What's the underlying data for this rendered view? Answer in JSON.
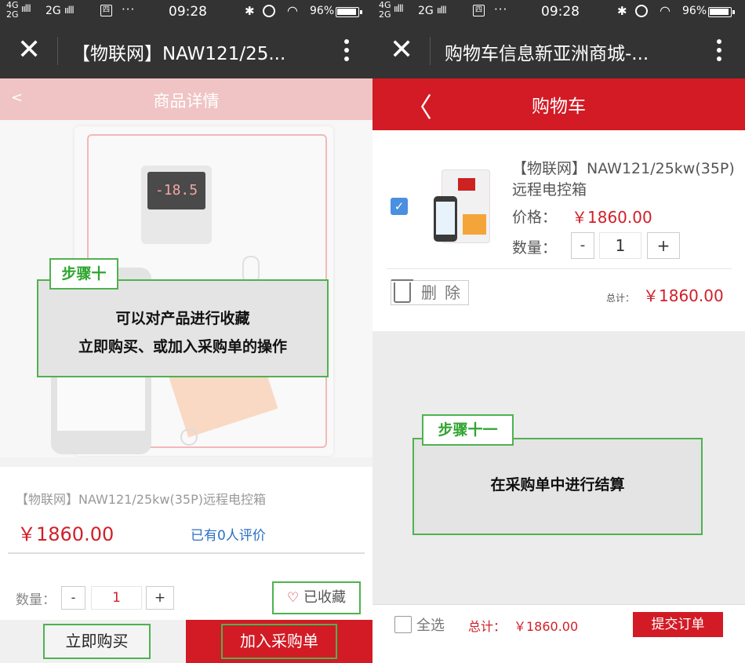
{
  "status_bar": {
    "net_top": "4G",
    "net_bottom": "2G",
    "net_second": "2G",
    "signal_glyph": "ıılll",
    "msg_glyph": "四",
    "dots": "···",
    "time": "09:28",
    "bt_glyph": "✱",
    "wifi_glyph": "◠",
    "battery": "96%"
  },
  "left": {
    "app_title": "【物联网】NAW121/25...",
    "sub_header_title": "商品详情",
    "back_glyph": "<",
    "lcd_text": "-18.5",
    "step": {
      "tag": "步骤十",
      "line1": "可以对产品进行收藏",
      "line2": "立即购买、或加入采购单的操作"
    },
    "product_name": "【物联网】NAW121/25kw(35P)远程电控箱",
    "price": "￥1860.00",
    "reviews": "已有0人评价",
    "qty_label": "数量：",
    "qty_minus": "-",
    "qty_value": "1",
    "qty_plus": "+",
    "fav_heart": "♡",
    "fav_label": "已收藏",
    "buy_now": "立即购买",
    "add_to_po": "加入采购单"
  },
  "right": {
    "app_title": "购物车信息新亚洲商城-...",
    "header_title": "购物车",
    "back_glyph": "〈",
    "check_glyph": "✓",
    "item_name": "【物联网】NAW121/25kw(35P)远程电控箱",
    "price_label": "价格：",
    "price": "￥1860.00",
    "qty_label": "数量：",
    "qty_minus": "-",
    "qty_value": "1",
    "qty_plus": "+",
    "delete_label": "删除",
    "total_label": "总计：",
    "total": "￥1860.00",
    "step": {
      "tag": "步骤十一",
      "text": "在采购单中进行结算"
    },
    "select_all": "全选",
    "footer_total_label": "总计：",
    "footer_total": "￥1860.00",
    "submit": "提交订单"
  },
  "colors": {
    "brand_red": "#d21b25",
    "price_red": "#d0202a",
    "step_green": "#4fb24f",
    "link_blue": "#2a70c4",
    "dark_bar": "#333333"
  },
  "icons": [
    "close-icon",
    "more-icon",
    "back-icon",
    "heart-icon",
    "trash-icon",
    "checkbox-icon",
    "battery-icon",
    "wifi-icon",
    "bluetooth-icon",
    "alarm-icon"
  ]
}
